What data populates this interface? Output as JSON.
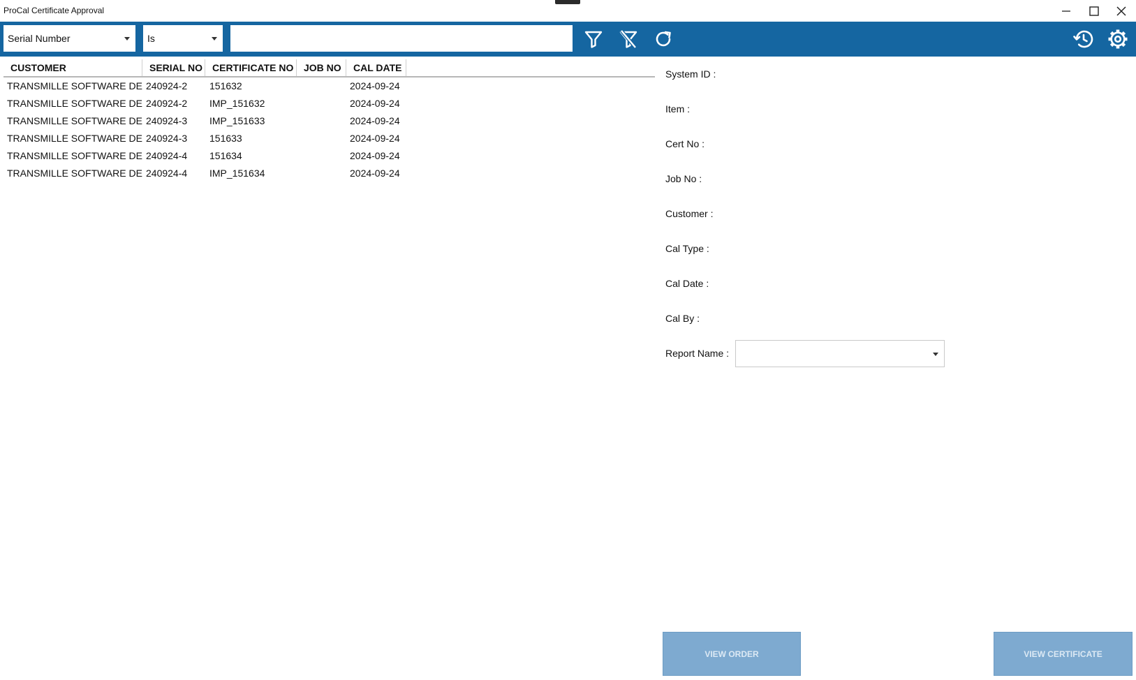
{
  "window": {
    "title": "ProCal Certificate Approval"
  },
  "toolbar": {
    "field_select": "Serial Number",
    "operator_select": "Is",
    "search_value": ""
  },
  "grid": {
    "columns": [
      "CUSTOMER",
      "SERIAL NO",
      "CERTIFICATE NO",
      "JOB NO",
      "CAL DATE"
    ],
    "rows": [
      {
        "customer": "TRANSMILLE SOFTWARE DEV",
        "serial": "240924-2",
        "cert": "151632",
        "job": "",
        "date": "2024-09-24"
      },
      {
        "customer": "TRANSMILLE SOFTWARE DEV",
        "serial": "240924-2",
        "cert": "IMP_151632",
        "job": "",
        "date": "2024-09-24"
      },
      {
        "customer": "TRANSMILLE SOFTWARE DEV",
        "serial": "240924-3",
        "cert": "IMP_151633",
        "job": "",
        "date": "2024-09-24"
      },
      {
        "customer": "TRANSMILLE SOFTWARE DEV",
        "serial": "240924-3",
        "cert": "151633",
        "job": "",
        "date": "2024-09-24"
      },
      {
        "customer": "TRANSMILLE SOFTWARE DEV",
        "serial": "240924-4",
        "cert": "151634",
        "job": "",
        "date": "2024-09-24"
      },
      {
        "customer": "TRANSMILLE SOFTWARE DEV",
        "serial": "240924-4",
        "cert": "IMP_151634",
        "job": "",
        "date": "2024-09-24"
      }
    ]
  },
  "details": {
    "system_id_label": "System ID :",
    "item_label": "Item :",
    "cert_no_label": "Cert No :",
    "job_no_label": "Job No :",
    "customer_label": "Customer :",
    "cal_type_label": "Cal Type :",
    "cal_date_label": "Cal Date :",
    "cal_by_label": "Cal By :",
    "report_name_label": "Report Name :",
    "report_name_value": ""
  },
  "buttons": {
    "view_order": "VIEW ORDER",
    "view_certificate": "VIEW CERTIFICATE"
  },
  "colors": {
    "toolbar_bg": "#1566a1",
    "disabled_button_bg": "#7eaad0"
  }
}
